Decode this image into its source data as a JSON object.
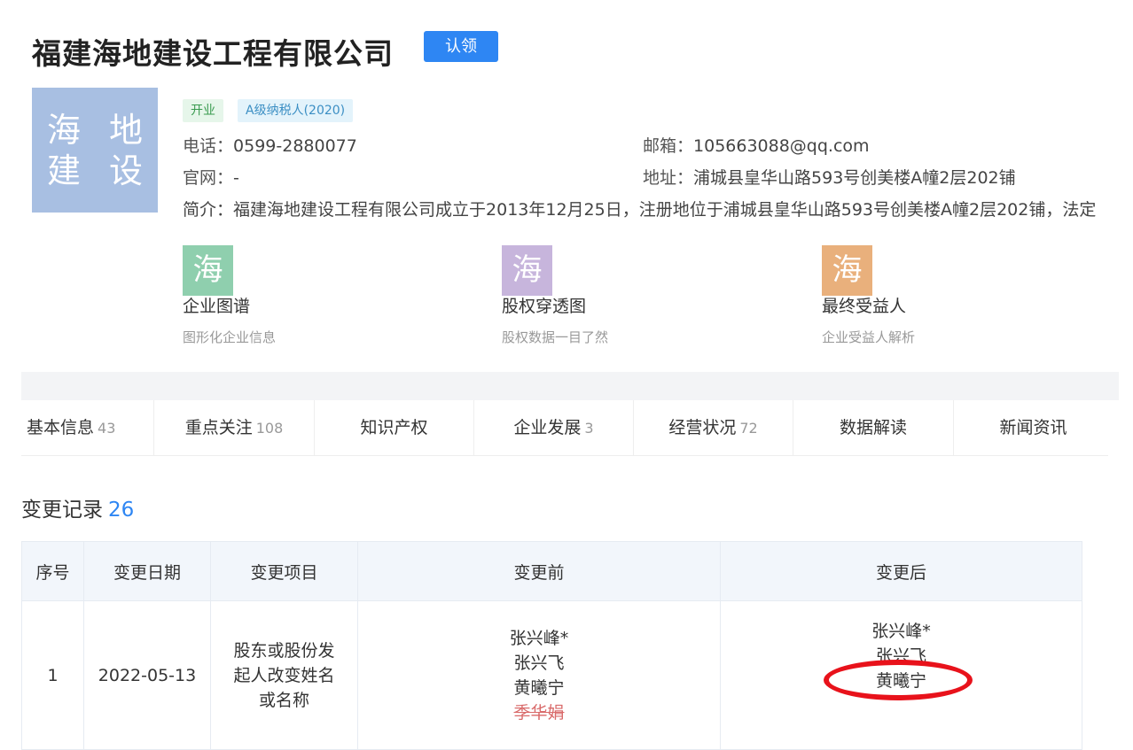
{
  "company": {
    "name": "福建海地建设工程有限公司",
    "claim_label": "认领",
    "logo_line1": "海 地",
    "logo_line2": "建 设"
  },
  "tags": {
    "status": "开业",
    "tax": "A级纳税人(2020)"
  },
  "contact": {
    "phone_label": "电话：",
    "phone": "0599-2880077",
    "website_label": "官网：",
    "website": "-",
    "email_label": "邮箱：",
    "email": "105663088@qq.com",
    "address_label": "地址：",
    "address": "浦城县皇华山路593号创美楼A幢2层202铺",
    "intro_label": "简介：",
    "intro": "福建海地建设工程有限公司成立于2013年12月25日，注册地位于浦城县皇华山路593号创美楼A幢2层202铺，法定"
  },
  "features": [
    {
      "icon_char": "海",
      "color": "#8fcfae",
      "title": "企业图谱",
      "desc": "图形化企业信息"
    },
    {
      "icon_char": "海",
      "color": "#c7b5dc",
      "title": "股权穿透图",
      "desc": "股权数据一目了然"
    },
    {
      "icon_char": "海",
      "color": "#e9b07c",
      "title": "最终受益人",
      "desc": "企业受益人解析"
    }
  ],
  "tabs": [
    {
      "label": "基本信息",
      "count": "43"
    },
    {
      "label": "重点关注",
      "count": "108"
    },
    {
      "label": "知识产权",
      "count": ""
    },
    {
      "label": "企业发展",
      "count": "3"
    },
    {
      "label": "经营状况",
      "count": "72"
    },
    {
      "label": "数据解读",
      "count": ""
    },
    {
      "label": "新闻资讯",
      "count": ""
    }
  ],
  "section": {
    "title": "变更记录",
    "count": "26"
  },
  "table": {
    "headers": [
      "序号",
      "变更日期",
      "变更项目",
      "变更前",
      "变更后"
    ],
    "rows": [
      {
        "index": "1",
        "date": "2022-05-13",
        "item": "股东或股份发起人改变姓名或名称",
        "before": [
          "张兴峰*",
          "张兴飞",
          "黄曦宁"
        ],
        "before_removed": "季华娟",
        "after": [
          "张兴峰*",
          "张兴飞",
          "黄曦宁"
        ]
      }
    ]
  },
  "colors": {
    "accent": "#2e86f3",
    "highlight_ellipse": "#e8121b"
  }
}
